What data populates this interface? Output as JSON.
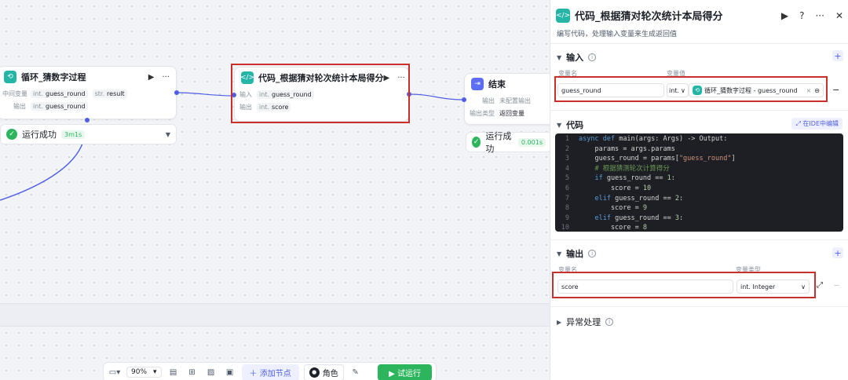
{
  "canvas": {
    "loop_node": {
      "title": "循环_猜数字过程",
      "row1_label": "中间变量",
      "row1_tags": [
        {
          "type": "int.",
          "name": "guess_round"
        },
        {
          "type": "str.",
          "name": "result"
        }
      ],
      "row2_label": "输出",
      "row2_tags": [
        {
          "type": "int.",
          "name": "guess_round"
        }
      ],
      "status": "运行成功",
      "duration": "3m1s"
    },
    "code_node": {
      "title": "代码_根据猜对轮次统计本局得分",
      "in_label": "输入",
      "in_type": "int.",
      "in_name": "guess_round",
      "out_label": "输出",
      "out_type": "int.",
      "out_name": "score"
    },
    "end_node": {
      "title": "结束",
      "row1_label": "输出",
      "row1_value": "未配置输出",
      "row2_label": "输出类型",
      "row2_value": "返回变量",
      "status": "运行成功",
      "duration": "0.001s"
    },
    "toolbar": {
      "zoom": "90%",
      "add_node": "添加节点",
      "role": "角色",
      "run": "试运行"
    }
  },
  "panel": {
    "title": "代码_根据猜对轮次统计本局得分",
    "description": "编写代码，处理输入变量来生成返回值",
    "input_section": {
      "title": "输入",
      "col_name": "变量名",
      "col_value": "变量值",
      "var_name": "guess_round",
      "type_short": "int.",
      "ref_value": "循环_猜数字过程 - guess_round"
    },
    "code_section": {
      "title": "代码",
      "ide_button": "在IDE中编辑",
      "lines": [
        "async def main(args: Args) -> Output:",
        "    params = args.params",
        "    guess_round = params[\"guess_round\"]",
        "    # 根据猜测轮次计算得分",
        "    if guess_round == 1:",
        "        score = 10",
        "    elif guess_round == 2:",
        "        score = 9",
        "    elif guess_round == 3:",
        "        score = 8"
      ]
    },
    "output_section": {
      "title": "输出",
      "col_name": "变量名",
      "col_type": "变量类型",
      "var_name": "score",
      "var_type": "int. Integer"
    },
    "exception_section": {
      "title": "异常处理"
    }
  },
  "colors": {
    "accent": "#4e5fe6",
    "success": "#2db55d",
    "highlight_box": "#c9302c",
    "code_bg": "#1e1f24"
  }
}
